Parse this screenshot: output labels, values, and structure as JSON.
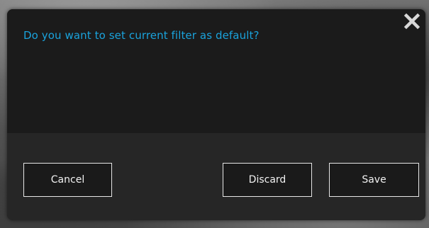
{
  "dialog": {
    "message": "Do you want to set current filter as default?",
    "close_icon": "close-icon",
    "buttons": {
      "cancel": "Cancel",
      "discard": "Discard",
      "save": "Save"
    }
  },
  "colors": {
    "accent": "#1aa3dc",
    "dialog_background": "#1f1f1f",
    "button_border": "#e6e6e6",
    "button_text": "#f2f2f2"
  }
}
